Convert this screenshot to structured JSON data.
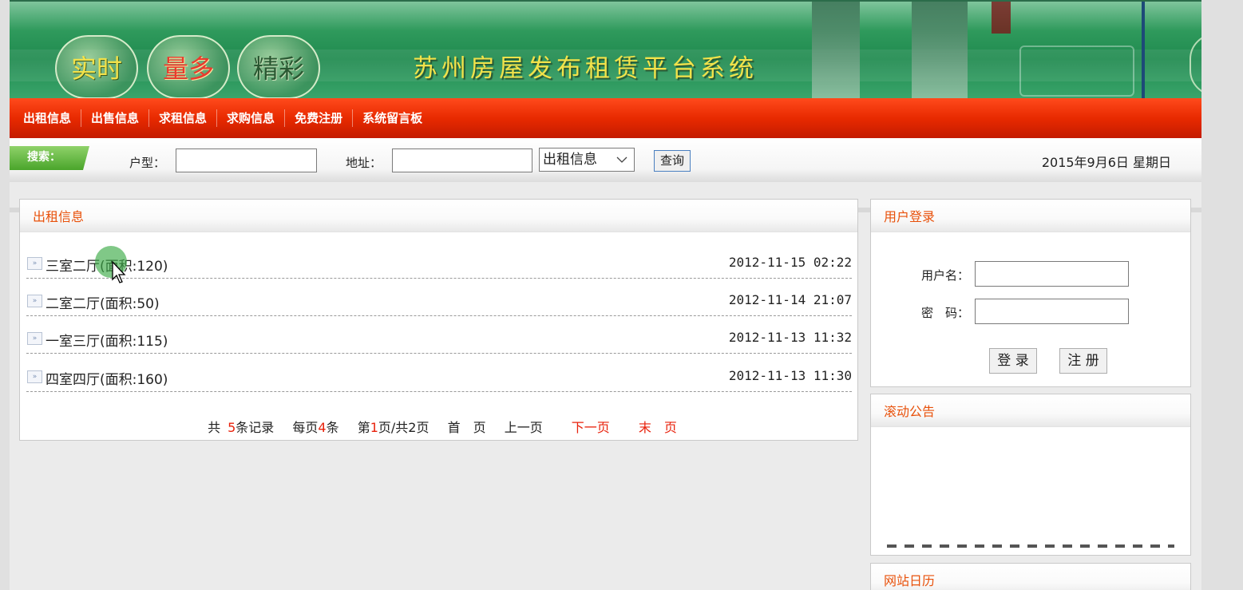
{
  "banner": {
    "bubbles": [
      "实时",
      "量多",
      "精彩"
    ],
    "title": "苏州房屋发布租赁平台系统"
  },
  "nav": {
    "items": [
      "出租信息",
      "出售信息",
      "求租信息",
      "求购信息",
      "免费注册",
      "系统留言板"
    ]
  },
  "search": {
    "tag": "搜索：",
    "type_label": "户型：",
    "type_value": "",
    "address_label": "地址：",
    "address_value": "",
    "category_selected": "出租信息",
    "query_button": "查询",
    "date": "2015年9月6日 星期日"
  },
  "listings": {
    "title": "出租信息",
    "rows": [
      {
        "title": "三室二厅(面积:120)",
        "time": "2012-11-15 02:22"
      },
      {
        "title": "二室二厅(面积:50)",
        "time": "2012-11-14 21:07"
      },
      {
        "title": "一室三厅(面积:115)",
        "time": "2012-11-13 11:32"
      },
      {
        "title": "四室四厅(面积:160)",
        "time": "2012-11-13 11:30"
      }
    ],
    "pager": {
      "total_prefix": "共",
      "total": "5",
      "total_suffix": "条记录",
      "per_prefix": "每页",
      "per": "4",
      "per_suffix": "条",
      "page_prefix": "第",
      "page": "1",
      "page_suffix": "页/共2页",
      "first": "首　页",
      "prev": "上一页",
      "next": "下一页",
      "last": "末　页"
    }
  },
  "login": {
    "title": "用户登录",
    "username_label": "用户名：",
    "password_label": "密　码：",
    "login_button": "登 录",
    "register_button": "注 册"
  },
  "notice": {
    "title": "滚动公告"
  },
  "calendar": {
    "title": "网站日历"
  },
  "icons": {
    "row_icon": "double-arrow-icon",
    "select_chevron": "chevron-down-icon",
    "cursor": "mouse-pointer-icon"
  },
  "colors": {
    "nav_red": "#e82a00",
    "heading_orange": "#e8510b",
    "accent_red": "#e8210b",
    "banner_green": "#2f9a5c"
  }
}
